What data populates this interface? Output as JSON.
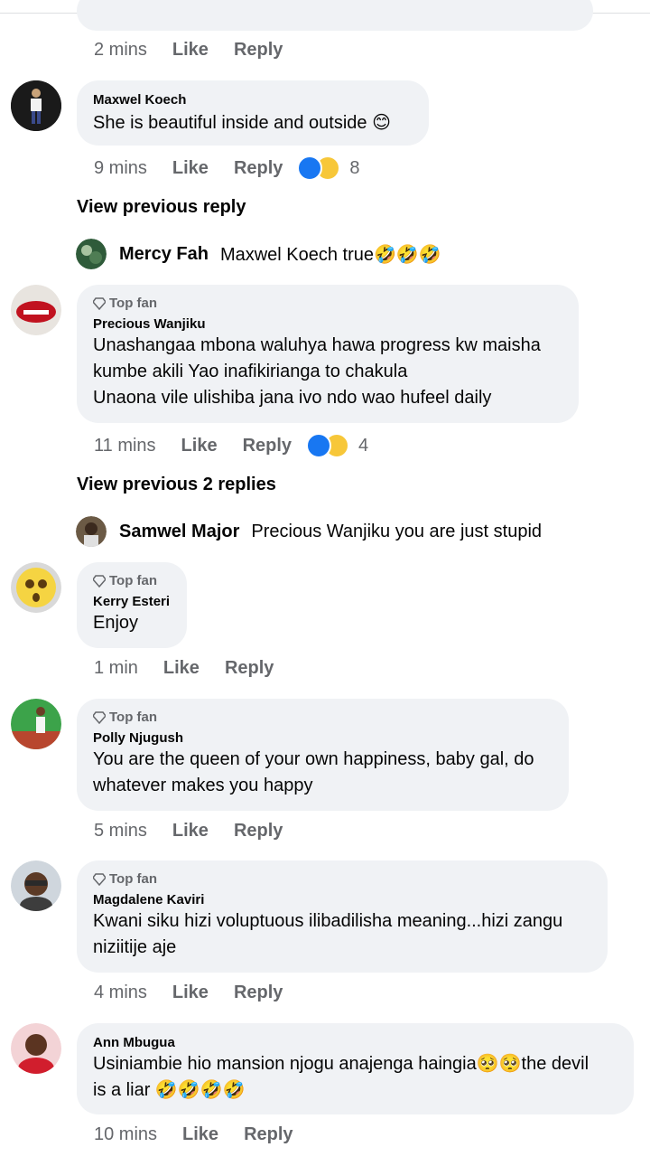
{
  "comments": [
    {
      "id": "c0",
      "meta": {
        "time": "2 mins",
        "like": "Like",
        "reply": "Reply"
      }
    },
    {
      "id": "c1",
      "name": "Maxwel Koech",
      "text": "She is beautiful inside and outside 😊",
      "meta": {
        "time": "9 mins",
        "like": "Like",
        "reply": "Reply",
        "reactions": "8"
      }
    },
    {
      "id": "c2",
      "topfan": "Top fan",
      "name": "Precious Wanjiku",
      "line1": "Unashangaa mbona waluhya hawa progress kw maisha",
      "line2": "kumbe akili Yao inafikirianga to chakula",
      "line3": "Unaona vile ulishiba jana ivo ndo wao hufeel daily",
      "meta": {
        "time": "11 mins",
        "like": "Like",
        "reply": "Reply",
        "reactions": "4"
      }
    },
    {
      "id": "c3",
      "topfan": "Top fan",
      "name": "Kerry Esteri",
      "text": "Enjoy",
      "meta": {
        "time": "1 min",
        "like": "Like",
        "reply": "Reply"
      }
    },
    {
      "id": "c4",
      "topfan": "Top fan",
      "name": "Polly Njugush",
      "line1": "You are the queen of your own happiness, baby gal, do",
      "line2": "whatever makes you happy",
      "meta": {
        "time": "5 mins",
        "like": "Like",
        "reply": "Reply"
      }
    },
    {
      "id": "c5",
      "topfan": "Top fan",
      "name": "Magdalene Kaviri",
      "line1": "Kwani siku hizi voluptuous ilibadilisha meaning...hizi zangu",
      "line2": "niziitije aje",
      "meta": {
        "time": "4 mins",
        "like": "Like",
        "reply": "Reply"
      }
    },
    {
      "id": "c6",
      "name": "Ann Mbugua",
      "line1": "Usiniambie hio mansion njogu anajenga haingia🥺🥺the devil",
      "line2": "is a liar 🤣🤣🤣🤣",
      "meta": {
        "time": "10 mins",
        "like": "Like",
        "reply": "Reply"
      }
    }
  ],
  "view_prev_1": "View previous reply",
  "view_prev_2": "View previous 2 replies",
  "reply1": {
    "name": "Mercy Fah",
    "text": "Maxwel Koech true🤣🤣🤣"
  },
  "reply2": {
    "name": "Samwel Major",
    "text": "Precious Wanjiku you are just stupid"
  }
}
